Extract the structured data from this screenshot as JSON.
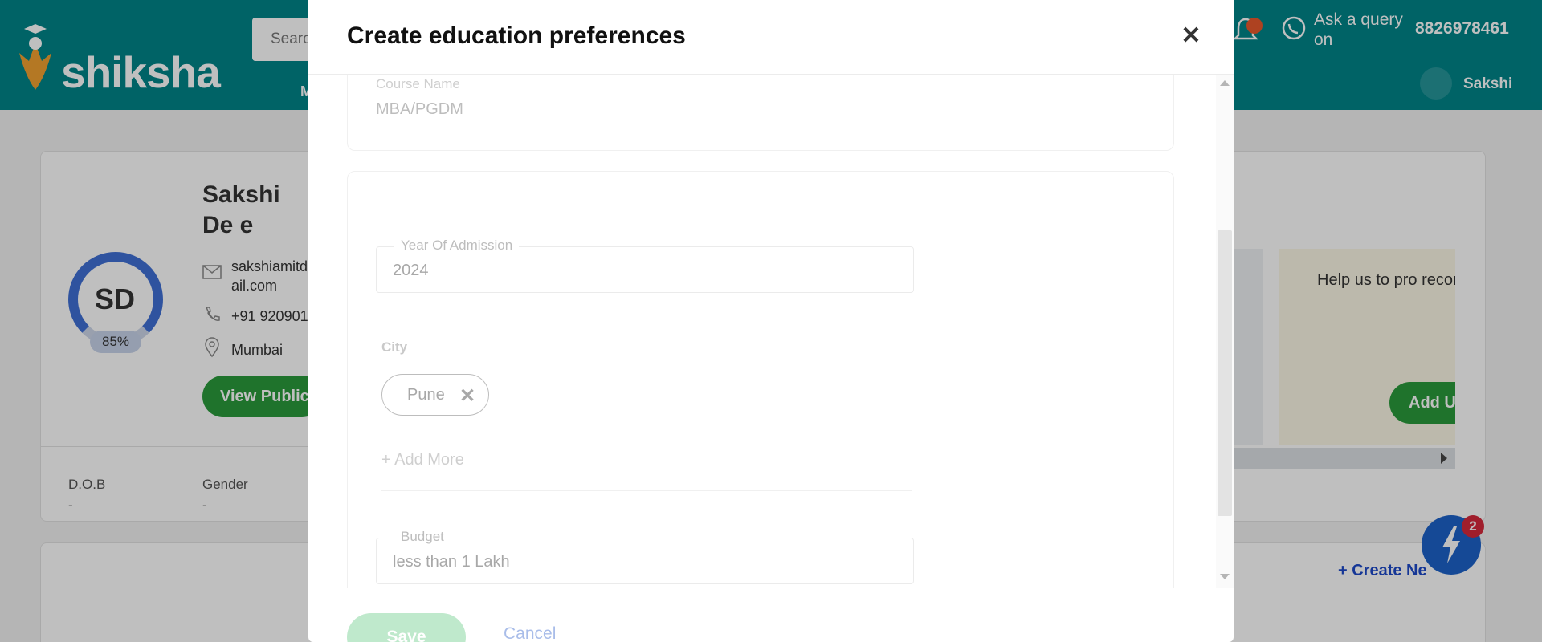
{
  "header": {
    "logo_text": "shiksha",
    "search_placeholder": "Searc",
    "nav_partial": "M",
    "ask_query": "Ask a query on",
    "phone": "8826978461",
    "user_name": "Sakshi"
  },
  "profile": {
    "initials": "SD",
    "completion": "85%",
    "name": "Sakshi De e",
    "email": "sakshiamitd ail.com",
    "phone": "+91 920901",
    "city": "Mumbai",
    "view_button": "View Public",
    "dob_label": "D.O.B",
    "dob_value": "-",
    "gender_label": "Gender",
    "gender_value": "-"
  },
  "promo": {
    "help_text": "Help us to pro recommendatio Graduati",
    "add_button": "Add U",
    "create_new": "+ Create Ne"
  },
  "fab": {
    "badge": "2"
  },
  "modal": {
    "title": "Create education preferences",
    "close_icon": "close-icon",
    "course_label": "Course Name",
    "course_value": "MBA/PGDM",
    "year_label": "Year Of Admission",
    "year_value": "2024",
    "city_label": "City",
    "city_chip": "Pune",
    "add_more": "+ Add More",
    "budget_label": "Budget",
    "budget_value": "less than 1 Lakh",
    "save_label": "Save",
    "cancel_label": "Cancel"
  },
  "colors": {
    "header_bg": "#008489",
    "save_bg": "#bfe9cc",
    "cancel_fg": "#a9bde9",
    "ring": "#3f6fd4"
  }
}
